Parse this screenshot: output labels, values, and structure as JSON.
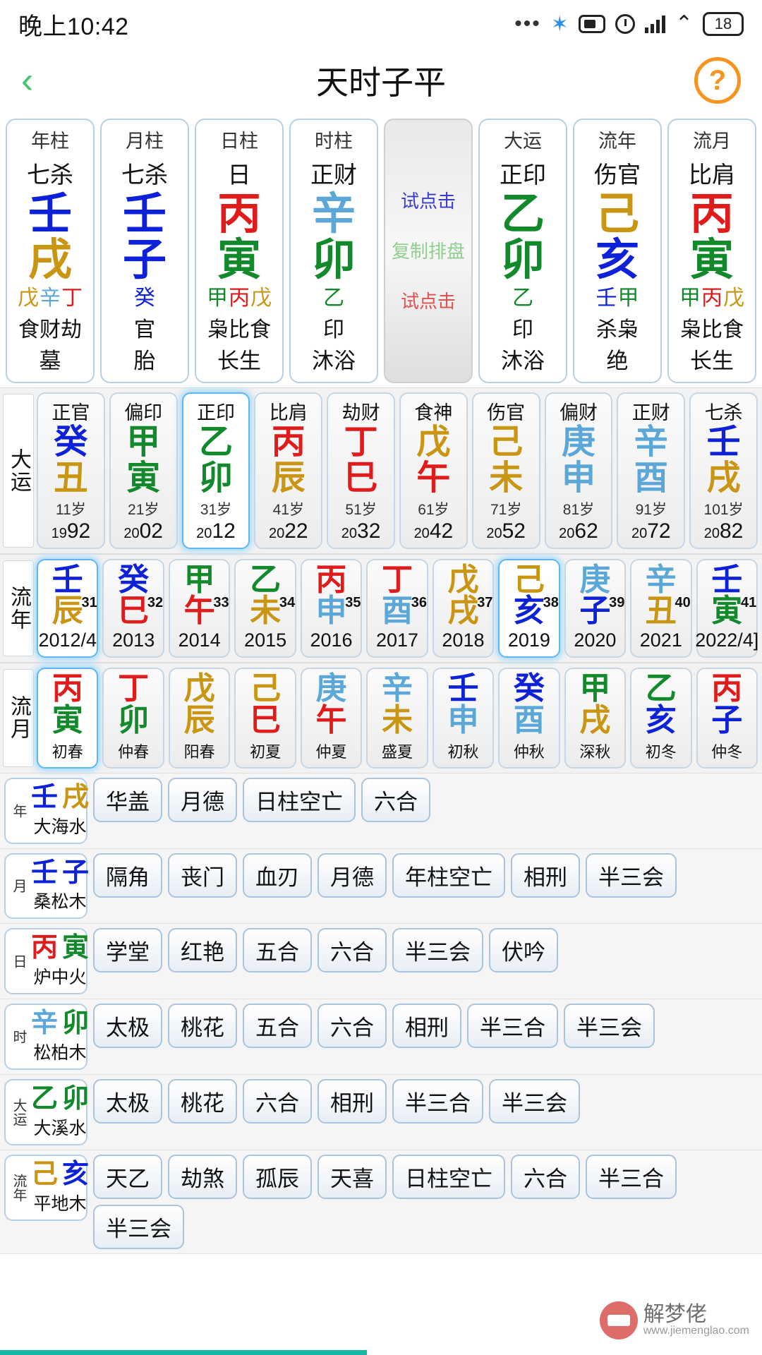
{
  "status_bar": {
    "time": "晚上10:42",
    "icons": [
      "more-dots-icon",
      "bluetooth-icon",
      "battery-saver-icon",
      "alarm-icon",
      "signal-bars-icon",
      "wifi-icon"
    ],
    "battery_level": "18"
  },
  "header": {
    "back_label": "‹",
    "title": "天时子平",
    "help_label": "?"
  },
  "pillars": {
    "items": [
      {
        "head": "年柱",
        "god": "七杀",
        "stem": "壬",
        "stem_color": "c-blue",
        "branch": "戌",
        "branch_color": "c-gold",
        "hidden": [
          {
            "t": "戊",
            "c": "c-gold"
          },
          {
            "t": "辛",
            "c": "c-ltblue"
          },
          {
            "t": "丁",
            "c": "c-red"
          }
        ],
        "hidden_gods": "食财劫",
        "stage": "墓"
      },
      {
        "head": "月柱",
        "god": "七杀",
        "stem": "壬",
        "stem_color": "c-blue",
        "branch": "子",
        "branch_color": "c-blue",
        "hidden": [
          {
            "t": "癸",
            "c": "c-blue"
          }
        ],
        "hidden_gods": "官",
        "stage": "胎"
      },
      {
        "head": "日柱",
        "god": "日",
        "stem": "丙",
        "stem_color": "c-red",
        "branch": "寅",
        "branch_color": "c-green",
        "hidden": [
          {
            "t": "甲",
            "c": "c-green"
          },
          {
            "t": "丙",
            "c": "c-red"
          },
          {
            "t": "戊",
            "c": "c-gold"
          }
        ],
        "hidden_gods": "枭比食",
        "stage": "长生"
      },
      {
        "head": "时柱",
        "god": "正财",
        "stem": "辛",
        "stem_color": "c-ltblue",
        "branch": "卯",
        "branch_color": "c-green",
        "hidden": [
          {
            "t": "乙",
            "c": "c-green"
          }
        ],
        "hidden_gods": "印",
        "stage": "沐浴"
      }
    ],
    "copy_card": {
      "line1": "试点击",
      "line2": "复制排盘",
      "line3": "试点击"
    },
    "luck_items": [
      {
        "head": "大运",
        "god": "正印",
        "stem": "乙",
        "stem_color": "c-green",
        "branch": "卯",
        "branch_color": "c-green",
        "hidden": [
          {
            "t": "乙",
            "c": "c-green"
          }
        ],
        "hidden_gods": "印",
        "stage": "沐浴"
      },
      {
        "head": "流年",
        "god": "伤官",
        "stem": "己",
        "stem_color": "c-gold",
        "branch": "亥",
        "branch_color": "c-blue",
        "hidden": [
          {
            "t": "壬",
            "c": "c-blue"
          },
          {
            "t": "甲",
            "c": "c-green"
          }
        ],
        "hidden_gods": "杀枭",
        "stage": "绝"
      },
      {
        "head": "流月",
        "god": "比肩",
        "stem": "丙",
        "stem_color": "c-red",
        "branch": "寅",
        "branch_color": "c-green",
        "hidden": [
          {
            "t": "甲",
            "c": "c-green"
          },
          {
            "t": "丙",
            "c": "c-red"
          },
          {
            "t": "戊",
            "c": "c-gold"
          }
        ],
        "hidden_gods": "枭比食",
        "stage": "长生"
      }
    ]
  },
  "dayun": {
    "label": "大运",
    "items": [
      {
        "god": "正官",
        "stem": "癸",
        "stem_color": "c-blue",
        "branch": "丑",
        "branch_color": "c-gold",
        "age": "11岁",
        "year_prefix": "19",
        "year_suffix": "92",
        "selected": false
      },
      {
        "god": "偏印",
        "stem": "甲",
        "stem_color": "c-green",
        "branch": "寅",
        "branch_color": "c-green",
        "age": "21岁",
        "year_prefix": "20",
        "year_suffix": "02",
        "selected": false
      },
      {
        "god": "正印",
        "stem": "乙",
        "stem_color": "c-green",
        "branch": "卯",
        "branch_color": "c-green",
        "age": "31岁",
        "year_prefix": "20",
        "year_suffix": "12",
        "selected": true
      },
      {
        "god": "比肩",
        "stem": "丙",
        "stem_color": "c-red",
        "branch": "辰",
        "branch_color": "c-gold",
        "age": "41岁",
        "year_prefix": "20",
        "year_suffix": "22",
        "selected": false
      },
      {
        "god": "劫财",
        "stem": "丁",
        "stem_color": "c-red",
        "branch": "巳",
        "branch_color": "c-red",
        "age": "51岁",
        "year_prefix": "20",
        "year_suffix": "32",
        "selected": false
      },
      {
        "god": "食神",
        "stem": "戊",
        "stem_color": "c-gold",
        "branch": "午",
        "branch_color": "c-red",
        "age": "61岁",
        "year_prefix": "20",
        "year_suffix": "42",
        "selected": false
      },
      {
        "god": "伤官",
        "stem": "己",
        "stem_color": "c-gold",
        "branch": "未",
        "branch_color": "c-gold",
        "age": "71岁",
        "year_prefix": "20",
        "year_suffix": "52",
        "selected": false
      },
      {
        "god": "偏财",
        "stem": "庚",
        "stem_color": "c-ltblue",
        "branch": "申",
        "branch_color": "c-ltblue",
        "age": "81岁",
        "year_prefix": "20",
        "year_suffix": "62",
        "selected": false
      },
      {
        "god": "正财",
        "stem": "辛",
        "stem_color": "c-ltblue",
        "branch": "酉",
        "branch_color": "c-ltblue",
        "age": "91岁",
        "year_prefix": "20",
        "year_suffix": "72",
        "selected": false
      },
      {
        "god": "七杀",
        "stem": "壬",
        "stem_color": "c-blue",
        "branch": "戌",
        "branch_color": "c-gold",
        "age": "101岁",
        "year_prefix": "20",
        "year_suffix": "82",
        "selected": false
      }
    ]
  },
  "liunian": {
    "label": "流年",
    "items": [
      {
        "stem": "壬",
        "stem_color": "c-blue",
        "branch": "辰",
        "branch_color": "c-gold",
        "age": "31",
        "year": "2012/4",
        "selected": true
      },
      {
        "stem": "癸",
        "stem_color": "c-blue",
        "branch": "巳",
        "branch_color": "c-red",
        "age": "32",
        "year": "2013",
        "selected": false
      },
      {
        "stem": "甲",
        "stem_color": "c-green",
        "branch": "午",
        "branch_color": "c-red",
        "age": "33",
        "year": "2014",
        "selected": false
      },
      {
        "stem": "乙",
        "stem_color": "c-green",
        "branch": "未",
        "branch_color": "c-gold",
        "age": "34",
        "year": "2015",
        "selected": false
      },
      {
        "stem": "丙",
        "stem_color": "c-red",
        "branch": "申",
        "branch_color": "c-ltblue",
        "age": "35",
        "year": "2016",
        "selected": false
      },
      {
        "stem": "丁",
        "stem_color": "c-red",
        "branch": "酉",
        "branch_color": "c-ltblue",
        "age": "36",
        "year": "2017",
        "selected": false
      },
      {
        "stem": "戊",
        "stem_color": "c-gold",
        "branch": "戌",
        "branch_color": "c-gold",
        "age": "37",
        "year": "2018",
        "selected": false
      },
      {
        "stem": "己",
        "stem_color": "c-gold",
        "branch": "亥",
        "branch_color": "c-blue",
        "age": "38",
        "year": "2019",
        "selected": true
      },
      {
        "stem": "庚",
        "stem_color": "c-ltblue",
        "branch": "子",
        "branch_color": "c-blue",
        "age": "39",
        "year": "2020",
        "selected": false
      },
      {
        "stem": "辛",
        "stem_color": "c-ltblue",
        "branch": "丑",
        "branch_color": "c-gold",
        "age": "40",
        "year": "2021",
        "selected": false
      },
      {
        "stem": "壬",
        "stem_color": "c-blue",
        "branch": "寅",
        "branch_color": "c-green",
        "age": "41",
        "year": "2022/4]",
        "selected": false
      }
    ]
  },
  "liuyue": {
    "label": "流月",
    "items": [
      {
        "stem": "丙",
        "stem_color": "c-red",
        "branch": "寅",
        "branch_color": "c-green",
        "season": "初春",
        "selected": true
      },
      {
        "stem": "丁",
        "stem_color": "c-red",
        "branch": "卯",
        "branch_color": "c-green",
        "season": "仲春",
        "selected": false
      },
      {
        "stem": "戊",
        "stem_color": "c-gold",
        "branch": "辰",
        "branch_color": "c-gold",
        "season": "阳春",
        "selected": false
      },
      {
        "stem": "己",
        "stem_color": "c-gold",
        "branch": "巳",
        "branch_color": "c-red",
        "season": "初夏",
        "selected": false
      },
      {
        "stem": "庚",
        "stem_color": "c-ltblue",
        "branch": "午",
        "branch_color": "c-red",
        "season": "仲夏",
        "selected": false
      },
      {
        "stem": "辛",
        "stem_color": "c-ltblue",
        "branch": "未",
        "branch_color": "c-gold",
        "season": "盛夏",
        "selected": false
      },
      {
        "stem": "壬",
        "stem_color": "c-blue",
        "branch": "申",
        "branch_color": "c-ltblue",
        "season": "初秋",
        "selected": false
      },
      {
        "stem": "癸",
        "stem_color": "c-blue",
        "branch": "酉",
        "branch_color": "c-ltblue",
        "season": "仲秋",
        "selected": false
      },
      {
        "stem": "甲",
        "stem_color": "c-green",
        "branch": "戌",
        "branch_color": "c-gold",
        "season": "深秋",
        "selected": false
      },
      {
        "stem": "乙",
        "stem_color": "c-green",
        "branch": "亥",
        "branch_color": "c-blue",
        "season": "初冬",
        "selected": false
      },
      {
        "stem": "丙",
        "stem_color": "c-red",
        "branch": "子",
        "branch_color": "c-blue",
        "season": "仲冬",
        "selected": false
      }
    ]
  },
  "shensha": {
    "rows": [
      {
        "tag": "年",
        "stem": "壬",
        "stem_color": "c-blue",
        "branch": "戌",
        "branch_color": "c-gold",
        "nayin": "大海水",
        "tags": [
          "华盖",
          "月德",
          "日柱空亡",
          "六合"
        ]
      },
      {
        "tag": "月",
        "stem": "壬",
        "stem_color": "c-blue",
        "branch": "子",
        "branch_color": "c-blue",
        "nayin": "桑松木",
        "tags": [
          "隔角",
          "丧门",
          "血刃",
          "月德",
          "年柱空亡",
          "相刑",
          "半三会"
        ]
      },
      {
        "tag": "日",
        "stem": "丙",
        "stem_color": "c-red",
        "branch": "寅",
        "branch_color": "c-green",
        "nayin": "炉中火",
        "tags": [
          "学堂",
          "红艳",
          "五合",
          "六合",
          "半三会",
          "伏吟"
        ]
      },
      {
        "tag": "时",
        "stem": "辛",
        "stem_color": "c-ltblue",
        "branch": "卯",
        "branch_color": "c-green",
        "nayin": "松柏木",
        "tags": [
          "太极",
          "桃花",
          "五合",
          "六合",
          "相刑",
          "半三合",
          "半三会"
        ]
      },
      {
        "tag": "大运",
        "stem": "乙",
        "stem_color": "c-green",
        "branch": "卯",
        "branch_color": "c-green",
        "nayin": "大溪水",
        "tags": [
          "太极",
          "桃花",
          "六合",
          "相刑",
          "半三合",
          "半三会"
        ]
      },
      {
        "tag": "流年",
        "stem": "己",
        "stem_color": "c-gold",
        "branch": "亥",
        "branch_color": "c-blue",
        "nayin": "平地木",
        "tags": [
          "天乙",
          "劫煞",
          "孤辰",
          "天喜",
          "日柱空亡",
          "六合",
          "半三合",
          "半三会"
        ]
      }
    ]
  },
  "watermark": {
    "title": "解梦佬",
    "url": "www.jiemenglao.com"
  }
}
